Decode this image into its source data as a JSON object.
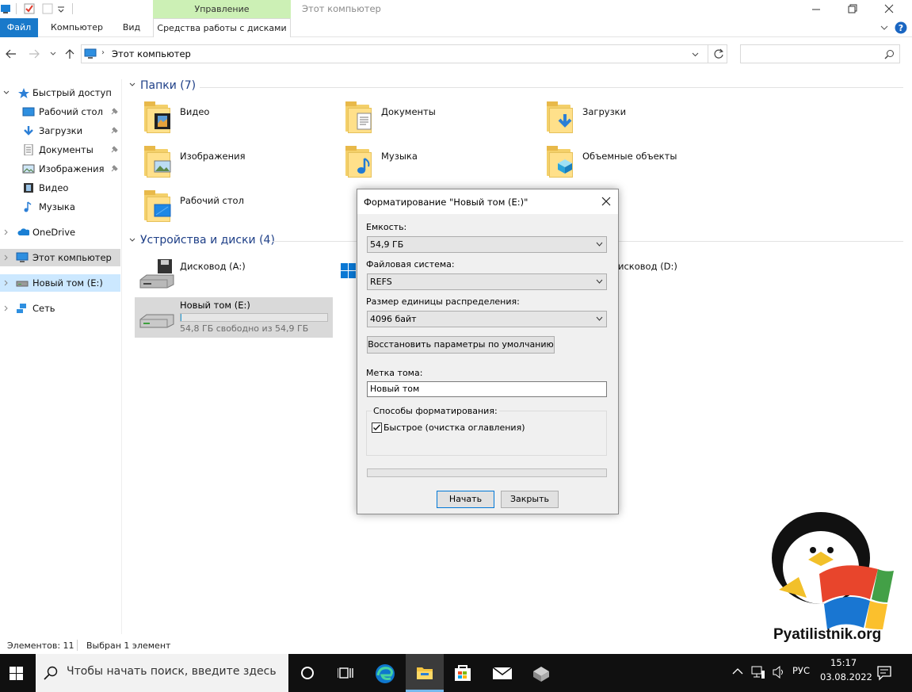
{
  "window": {
    "title": "Этот компьютер",
    "context_tab_group": "Управление"
  },
  "ribbon": {
    "tabs": [
      "Файл",
      "Компьютер",
      "Вид",
      "Средства работы с дисками"
    ]
  },
  "address": {
    "path": "Этот компьютер",
    "search_placeholder": ""
  },
  "nav": {
    "quick_access": "Быстрый доступ",
    "items": [
      "Рабочий стол",
      "Загрузки",
      "Документы",
      "Изображения",
      "Видео",
      "Музыка"
    ],
    "onedrive": "OneDrive",
    "this_pc": "Этот компьютер",
    "new_volume": "Новый том (E:)",
    "network": "Сеть"
  },
  "content": {
    "folders_header": "Папки (7)",
    "folders": [
      "Видео",
      "Документы",
      "Загрузки",
      "Изображения",
      "Музыка",
      "Объемные объекты",
      "Рабочий стол"
    ],
    "devices_header": "Устройства и диски (4)",
    "drive_a": "Дисковод (A:)",
    "drive_d_partial": "исковод (D:)",
    "drive_e": "Новый том (E:)",
    "drive_e_free": "54,8 ГБ свободно из 54,9 ГБ",
    "drive_e_used_fraction": 0.002
  },
  "status": {
    "items": "Элементов: 11",
    "selected": "Выбран 1 элемент"
  },
  "dialog": {
    "title": "Форматирование \"Новый том (E:)\"",
    "capacity_label": "Емкость:",
    "capacity_value": "54,9 ГБ",
    "fs_label": "Файловая система:",
    "fs_value": "REFS",
    "alloc_label": "Размер единицы распределения:",
    "alloc_value": "4096 байт",
    "restore_button": "Восстановить параметры по умолчанию",
    "volume_label": "Метка тома:",
    "volume_value": "Новый том",
    "format_options_label": "Способы форматирования:",
    "quick_format": "Быстрое (очистка оглавления)",
    "quick_format_checked": true,
    "start_button": "Начать",
    "close_button": "Закрыть"
  },
  "taskbar": {
    "search_placeholder": "Чтобы начать поиск, введите здесь",
    "lang": "РУС",
    "time": "15:17",
    "date": "03.08.2022"
  },
  "watermark": "Pyatilistnik.org"
}
